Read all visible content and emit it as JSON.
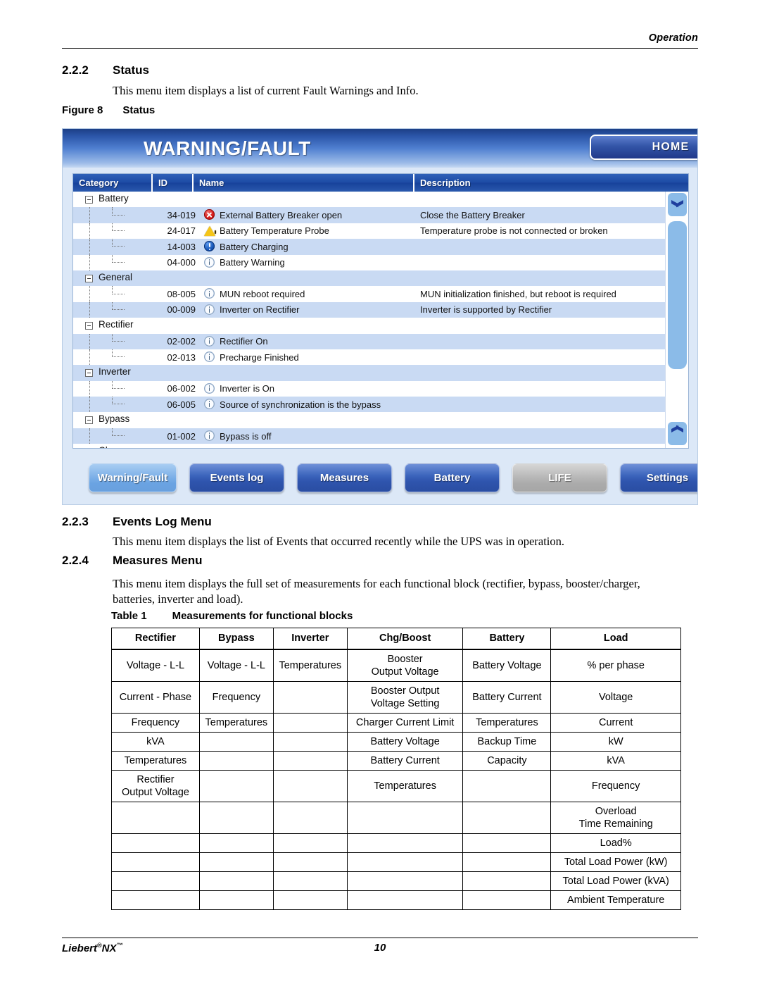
{
  "running_head": "Operation",
  "sections": [
    {
      "number": "2.2.2",
      "title": "Status",
      "body": "This menu item displays a list of current Fault Warnings and Info."
    },
    {
      "number": "2.2.3",
      "title": "Events Log Menu",
      "body": "This menu item displays the list of Events that occurred recently while the UPS was in operation."
    },
    {
      "number": "2.2.4",
      "title": "Measures Menu",
      "body": "This menu item displays the full set of measurements for each functional block (rectifier, bypass, booster/charger, batteries, inverter and load)."
    }
  ],
  "figure": {
    "label": "Figure 8",
    "caption": "Status"
  },
  "ups_panel": {
    "title": "WARNING/FAULT",
    "home_button": "HOME",
    "columns": [
      "Category",
      "ID",
      "Name",
      "Description"
    ],
    "rows": [
      {
        "type": "category",
        "category": "Battery",
        "id": "",
        "icon": "",
        "name": "",
        "description": "",
        "shaded": false
      },
      {
        "type": "item",
        "category": "",
        "id": "34-019",
        "icon": "error-icon",
        "name": "External Battery Breaker open",
        "description": "Close the Battery Breaker",
        "shaded": true
      },
      {
        "type": "item",
        "category": "",
        "id": "24-017",
        "icon": "warning-icon",
        "name": "Battery Temperature Probe",
        "description": "Temperature probe is not connected or broken",
        "shaded": false
      },
      {
        "type": "item",
        "category": "",
        "id": "14-003",
        "icon": "info-icon",
        "name": "Battery Charging",
        "description": "",
        "shaded": true
      },
      {
        "type": "item",
        "category": "",
        "id": "04-000",
        "icon": "info-light-icon",
        "name": "Battery Warning",
        "description": "",
        "shaded": false
      },
      {
        "type": "category",
        "category": "General",
        "id": "",
        "icon": "",
        "name": "",
        "description": "",
        "shaded": true
      },
      {
        "type": "item",
        "category": "",
        "id": "08-005",
        "icon": "info-light-icon",
        "name": "MUN reboot required",
        "description": "MUN initialization finished, but reboot is required",
        "shaded": false
      },
      {
        "type": "item",
        "category": "",
        "id": "00-009",
        "icon": "info-light-icon",
        "name": "Inverter on Rectifier",
        "description": "Inverter is supported by Rectifier",
        "shaded": true
      },
      {
        "type": "category",
        "category": "Rectifier",
        "id": "",
        "icon": "",
        "name": "",
        "description": "",
        "shaded": false
      },
      {
        "type": "item",
        "category": "",
        "id": "02-002",
        "icon": "info-light-icon",
        "name": "Rectifier On",
        "description": "",
        "shaded": true
      },
      {
        "type": "item",
        "category": "",
        "id": "02-013",
        "icon": "info-light-icon",
        "name": "Precharge Finished",
        "description": "",
        "shaded": false
      },
      {
        "type": "category",
        "category": "Inverter",
        "id": "",
        "icon": "",
        "name": "",
        "description": "",
        "shaded": true
      },
      {
        "type": "item",
        "category": "",
        "id": "06-002",
        "icon": "info-light-icon",
        "name": "Inverter is On",
        "description": "",
        "shaded": false
      },
      {
        "type": "item",
        "category": "",
        "id": "06-005",
        "icon": "info-light-icon",
        "name": "Source of synchronization is the bypass",
        "description": "",
        "shaded": true
      },
      {
        "type": "category",
        "category": "Bypass",
        "id": "",
        "icon": "",
        "name": "",
        "description": "",
        "shaded": false
      },
      {
        "type": "item",
        "category": "",
        "id": "01-002",
        "icon": "info-light-icon",
        "name": "Bypass is off",
        "description": "",
        "shaded": true
      },
      {
        "type": "category",
        "category": "Charger",
        "id": "",
        "icon": "",
        "name": "",
        "description": "",
        "shaded": false
      }
    ],
    "scrollbar": {
      "up": "scroll-up",
      "down": "scroll-down"
    },
    "nav_buttons": [
      {
        "label": "Warning/Fault",
        "state": "active"
      },
      {
        "label": "Events log",
        "state": "normal"
      },
      {
        "label": "Measures",
        "state": "normal"
      },
      {
        "label": "Battery",
        "state": "normal"
      },
      {
        "label": "LIFE",
        "state": "disabled"
      },
      {
        "label": "Settings",
        "state": "normal"
      }
    ],
    "colors": {
      "header_blue": "#1d4ba5",
      "row_shade": "#c9daf3",
      "panel_bg": "#dce8f7",
      "scroll_blue": "#8bbbe8",
      "error_red": "#d61c1c",
      "warning_yellow": "#f5c518",
      "info_blue": "#1453b4"
    }
  },
  "table1": {
    "label": "Table 1",
    "caption": "Measurements for functional blocks",
    "headers": [
      "Rectifier",
      "Bypass",
      "Inverter",
      "Chg/Boost",
      "Battery",
      "Load"
    ],
    "rows": [
      [
        "Voltage - L-L",
        "Voltage - L-L",
        "Temperatures",
        "Booster\nOutput Voltage",
        "Battery Voltage",
        "% per phase"
      ],
      [
        "Current - Phase",
        "Frequency",
        "",
        "Booster Output\nVoltage Setting",
        "Battery Current",
        "Voltage"
      ],
      [
        "Frequency",
        "Temperatures",
        "",
        "Charger Current Limit",
        "Temperatures",
        "Current"
      ],
      [
        "kVA",
        "",
        "",
        "Battery Voltage",
        "Backup Time",
        "kW"
      ],
      [
        "Temperatures",
        "",
        "",
        "Battery Current",
        "Capacity",
        "kVA"
      ],
      [
        "Rectifier\nOutput Voltage",
        "",
        "",
        "Temperatures",
        "",
        "Frequency"
      ],
      [
        "",
        "",
        "",
        "",
        "",
        "Overload\nTime Remaining"
      ],
      [
        "",
        "",
        "",
        "",
        "",
        "Load%"
      ],
      [
        "",
        "",
        "",
        "",
        "",
        "Total Load Power (kW)"
      ],
      [
        "",
        "",
        "",
        "",
        "",
        "Total Load Power (kVA)"
      ],
      [
        "",
        "",
        "",
        "",
        "",
        "Ambient Temperature"
      ]
    ]
  },
  "footer": {
    "product": "Liebert",
    "product_reg": "®",
    "product_model": "NX",
    "product_tm": "™",
    "page_number": "10"
  }
}
